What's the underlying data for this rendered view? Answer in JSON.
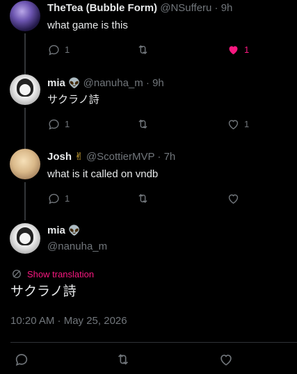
{
  "replies": [
    {
      "name": "TheTea (Bubble Form)",
      "handle": "@NSufferu · 9h",
      "text": "what game is this",
      "reply_count": "1",
      "retweet_count": "",
      "like_count": "1",
      "liked": true,
      "avatar": "purple-anime-avatar"
    },
    {
      "name": "mia",
      "badge": "alien-emoji",
      "handle": "@nanuha_m · 9h",
      "text": "サクラノ詩",
      "reply_count": "1",
      "retweet_count": "",
      "like_count": "1",
      "liked": false,
      "avatar": "anime-girl-avatar"
    },
    {
      "name": "Josh",
      "badge_emoji": "✌",
      "handle": "@ScottierMVP · 7h",
      "text": "what is it called on vndb",
      "reply_count": "1",
      "retweet_count": "",
      "like_count": "",
      "liked": false,
      "avatar": "blonde-anime-avatar"
    }
  ],
  "main_tweet": {
    "name": "mia",
    "handle": "@nanuha_m",
    "translate_label": "Show translation",
    "text": "サクラノ詩",
    "timestamp": "10:20 AM · May 25, 2026"
  },
  "colors": {
    "background": "#000000",
    "text": "#e7e9ea",
    "muted": "#71767b",
    "like_pink": "#f91880",
    "divider": "#2f3336"
  }
}
